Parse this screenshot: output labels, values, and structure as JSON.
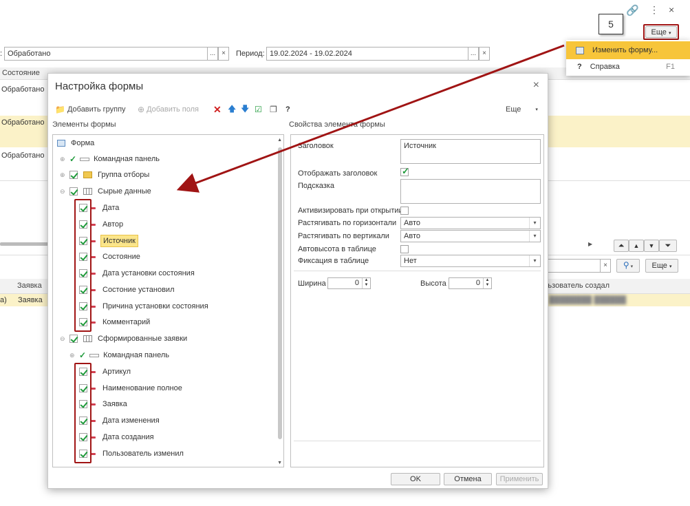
{
  "window": {
    "link_icon": "link-icon",
    "menu_icon": "⋮",
    "close": "×"
  },
  "filter_bar": {
    "status_value": "Обработано",
    "period_label": "Период:",
    "period_value": "19.02.2024 - 19.02.2024",
    "more_label": "Еще"
  },
  "top_grid": {
    "col_state": "Состояние",
    "rows": [
      "Обработано",
      "Обработано",
      "Обработано"
    ]
  },
  "bottom_grid": {
    "col_request": "Заявка",
    "row_prefix": "а)",
    "row_request": "Заявка",
    "col_user_created": "льзователь создал",
    "blurred_user": "████████ ██████",
    "more_label": "Еще"
  },
  "callout": "5",
  "context_menu": {
    "items": [
      {
        "label": "Изменить форму...",
        "icon": "form-settings-icon",
        "shortcut": ""
      },
      {
        "label": "Справка",
        "icon": "?",
        "shortcut": "F1"
      }
    ]
  },
  "dialog": {
    "title": "Настройка формы",
    "toolbar": {
      "add_group": "Добавить группу",
      "add_field": "Добавить поля",
      "more": "Еще"
    },
    "left_label": "Элементы формы",
    "right_label": "Свойства элемента формы",
    "tree": {
      "root": "Форма",
      "cmd_panel": "Командная панель",
      "group_filters": "Группа отборы",
      "raw_data": "Сырые данные",
      "raw_children": [
        "Дата",
        "Автор",
        "Источник",
        "Состояние",
        "Дата установки состояния",
        "Состоние установил",
        "Причина установки состояния",
        "Комментарий"
      ],
      "generated": "Сформированные заявки",
      "gen_cmd_panel": "Командная панель",
      "gen_children": [
        "Артикул",
        "Наименование полное",
        "Заявка",
        "Дата изменения",
        "Дата создания",
        "Пользователь изменил"
      ]
    },
    "props": {
      "title_label": "Заголовок",
      "title_value": "Источник",
      "show_title_label": "Отображать заголовок",
      "hint_label": "Подсказка",
      "activate_label": "Активизировать при открытии",
      "stretch_h_label": "Растягивать по горизонтали",
      "stretch_h_value": "Авто",
      "stretch_v_label": "Растягивать по вертикали",
      "stretch_v_value": "Авто",
      "autoheight_label": "Автовысота в таблице",
      "fix_label": "Фиксация в таблице",
      "fix_value": "Нет",
      "width_label": "Ширина",
      "width_value": "0",
      "height_label": "Высота",
      "height_value": "0"
    },
    "buttons": {
      "ok": "OK",
      "cancel": "Отмена",
      "apply": "Применить"
    }
  },
  "colors": {
    "accent_red": "#a01414",
    "highlight": "#fbf2c8",
    "menu_highlight": "#f7c53a",
    "check_green": "#1e9a3a"
  }
}
